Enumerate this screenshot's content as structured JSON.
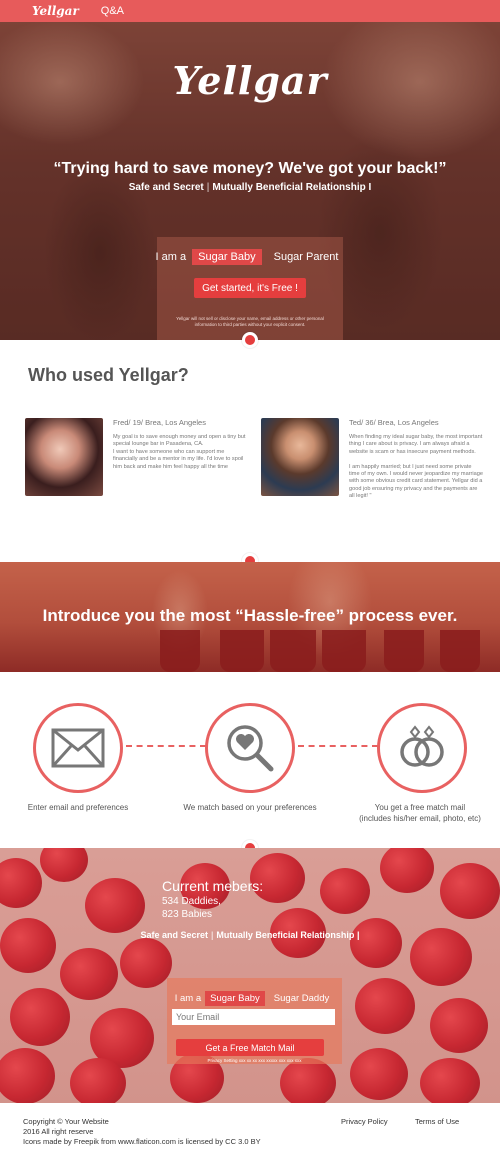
{
  "topbar": {
    "logo": "Yellgar",
    "nav": [
      "Q&A"
    ]
  },
  "hero": {
    "logo": "Yellgar",
    "quote": "“Trying hard to save money? We've got your back!”",
    "tagline_parts": [
      "Safe and Secret",
      "|",
      "Mutually Beneficial Relationship",
      "I"
    ],
    "iam_label": "I am a",
    "options": [
      "Sugar Baby",
      "Sugar Parent"
    ],
    "selected_option": "Sugar Baby",
    "cta": "Get started, it's Free !",
    "disclaimer": "Yellgar will not sell or disclose your name, email address or other personal information to third parties without your explicit consent."
  },
  "who": {
    "title": "Who used Yellgar?",
    "profiles": [
      {
        "name": "Fred/ 19/ Brea, Los Angeles",
        "text": "My goal is to save enough money and open a tiny but special lounge bar in Pasadena, CA.\nI want to have someone who can support me financially and be a mentor in my life. I'd love to spoil him back and make him feel happy all the time"
      },
      {
        "name": "Ted/ 36/ Brea, Los Angeles",
        "text": "When finding my ideal sugar baby, the most important thing I care about is privacy. I am always afraid a website is scam or has insecure payment methods.\n\nI am happily married; but I just need some private time of my own. I would never jeopardize my marriage with some obvious credit card statement. Yellgar did a good job ensuring my privacy and the payments are all legit! \""
      }
    ]
  },
  "process": {
    "title": "Introduce you the most  “Hassle-free” process ever.",
    "steps": [
      {
        "icon": "envelope-icon",
        "label": "Enter email and preferences"
      },
      {
        "icon": "magnifier-heart-icon",
        "label": "We match based on your preferences"
      },
      {
        "icon": "rings-icon",
        "label": "You get a free match mail\n(includes his/her email, photo, etc)"
      }
    ]
  },
  "members": {
    "title": "Current mebers:",
    "lines": [
      "534 Daddies,",
      "823 Babies"
    ],
    "tagline_parts": [
      "Safe and Secret",
      "|",
      "Mutually Beneficial Relationship",
      "|"
    ],
    "iam_label": "I am a",
    "options": [
      "Sugar Baby",
      "Sugar Daddy"
    ],
    "selected_option": "Sugar Baby",
    "email_placeholder": "Your Email",
    "cta": "Get a Free Match Mail",
    "privacy": "Privacy Setting xxx xx xx xxx xxxxx xxx xxx xxx"
  },
  "footer": {
    "lines": [
      "Copyright © Your Website",
      "2016 All right reserve",
      "Icons made by Freepik from www.flaticon.com is licensed by CC 3.0 BY"
    ],
    "links": [
      "Privacy Policy",
      "Terms of Use"
    ]
  },
  "colors": {
    "accent": "#e53e3e",
    "topbar": "#e75b5b",
    "step_ring": "#e86161"
  }
}
